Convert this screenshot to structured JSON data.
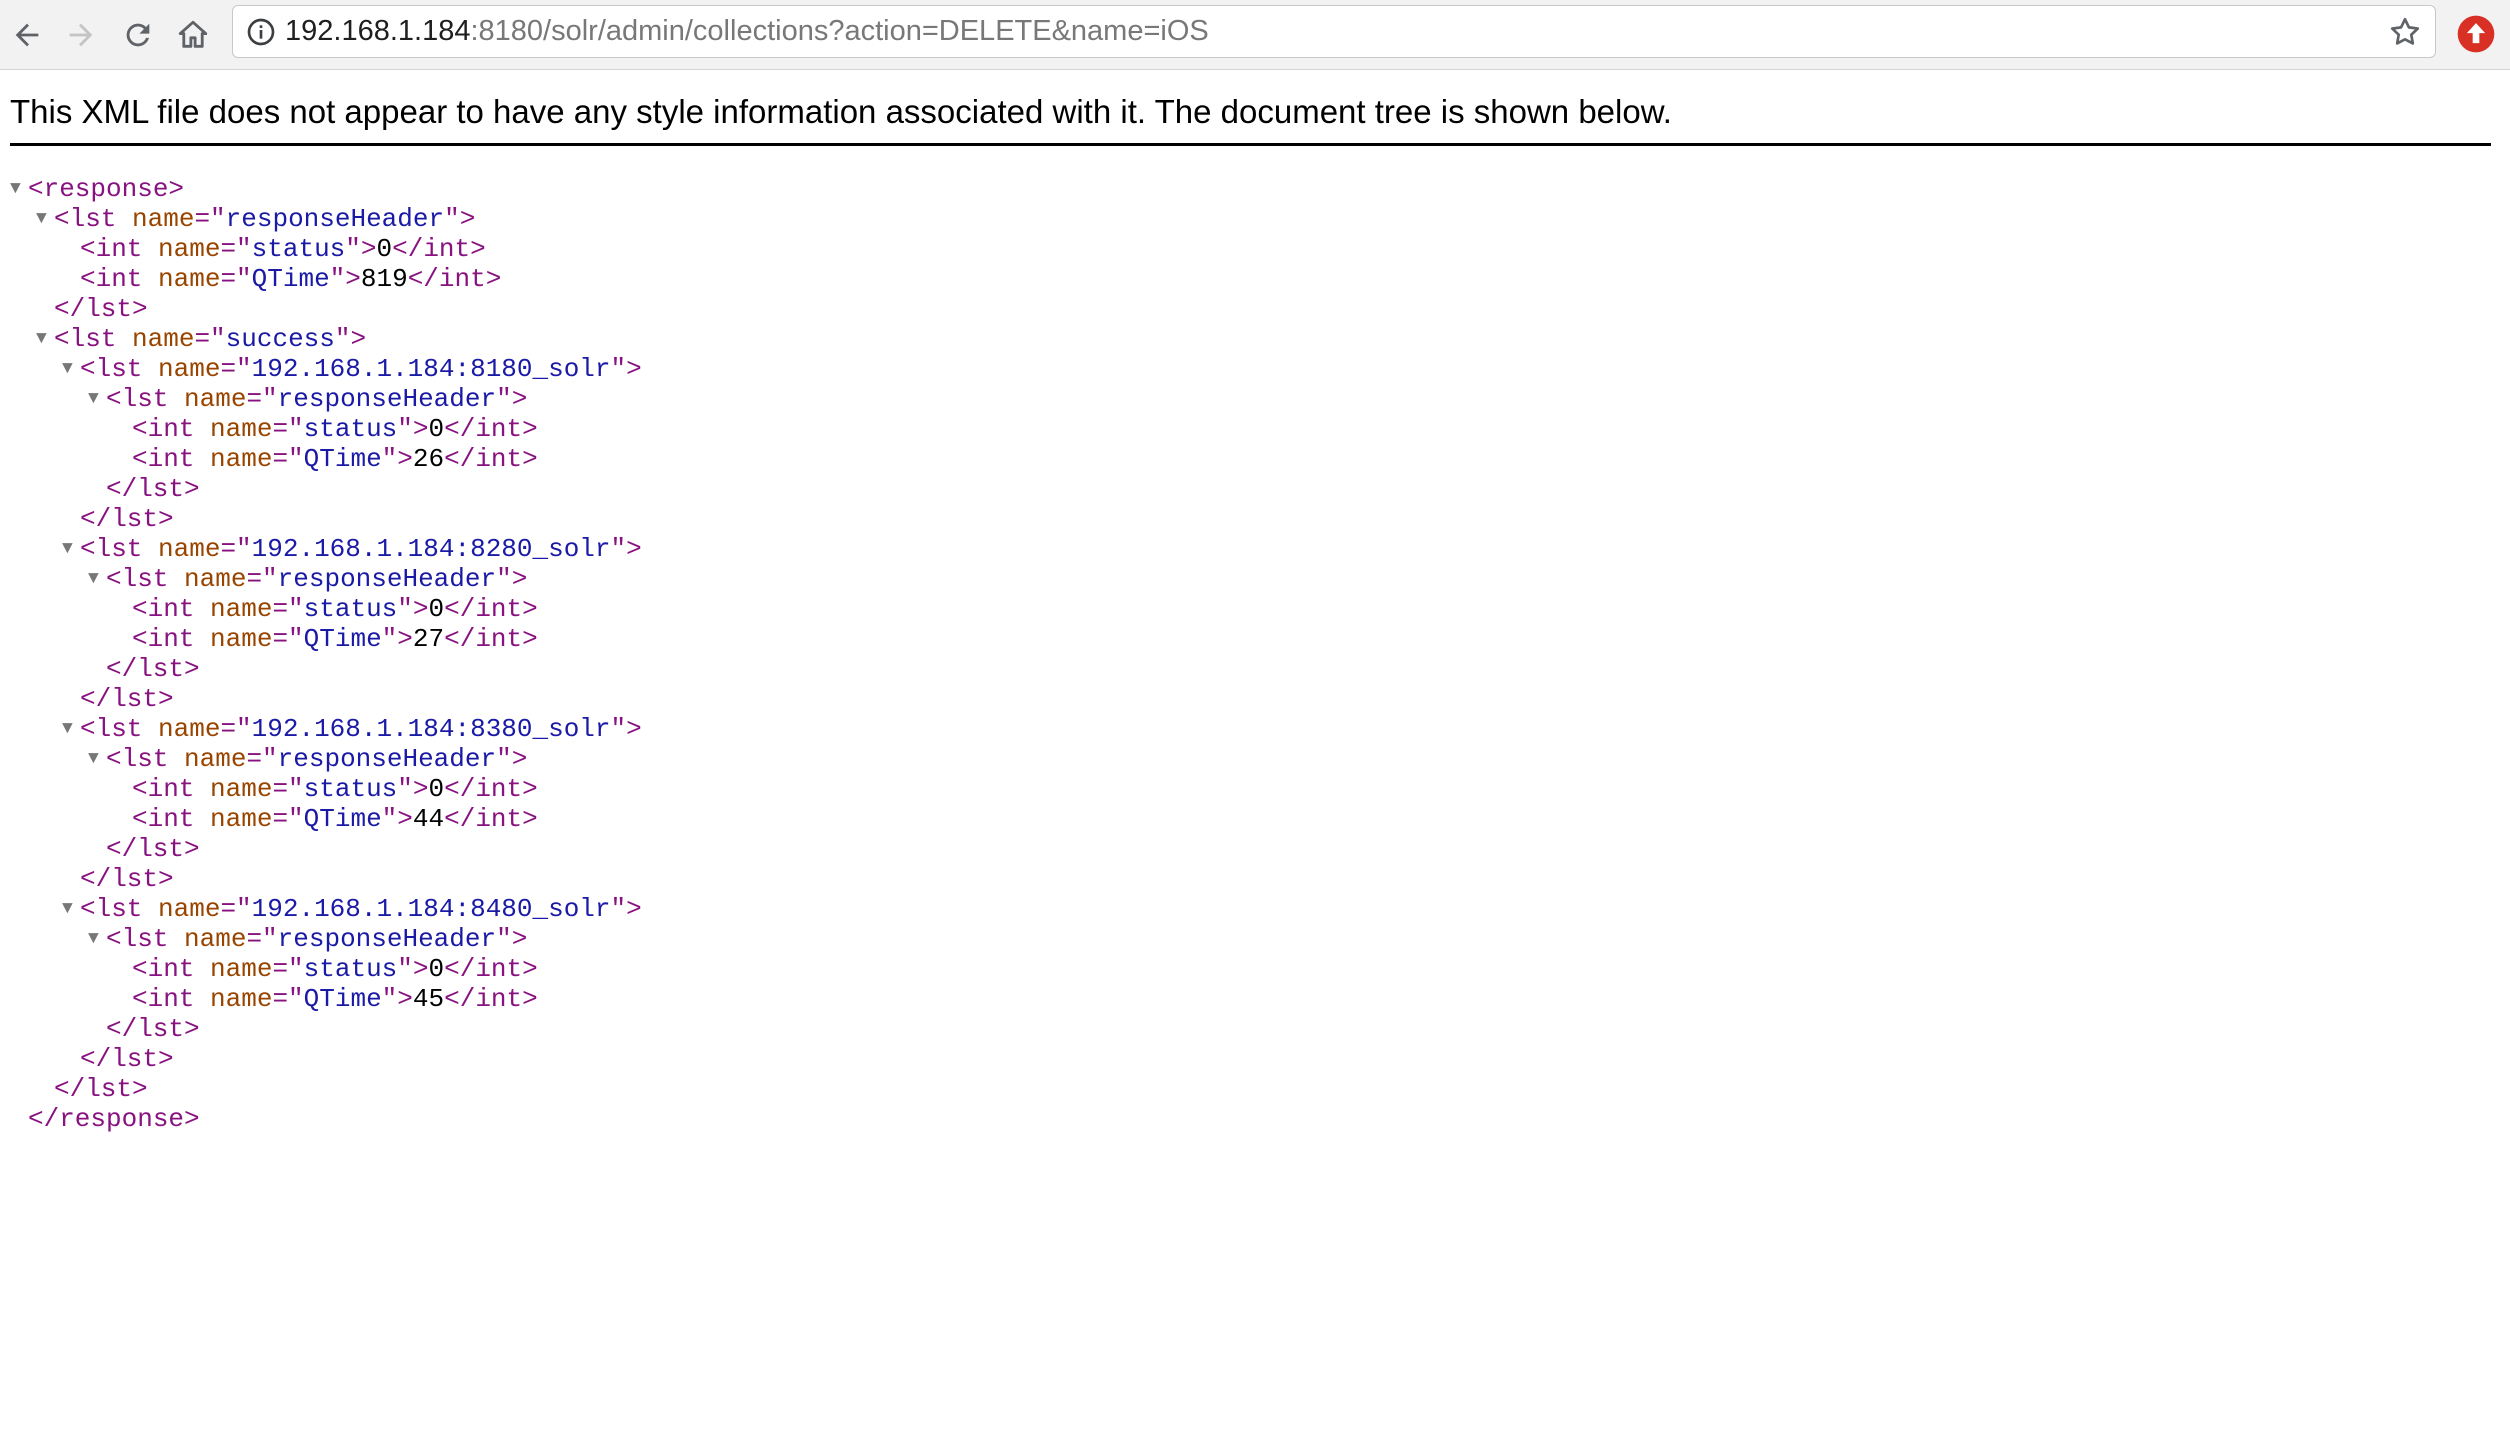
{
  "browser": {
    "url_host": "192.168.1.184",
    "url_rest": ":8180/solr/admin/collections?action=DELETE&name=iOS",
    "icons": {
      "back": "back-arrow-icon",
      "forward": "forward-arrow-icon",
      "reload": "reload-icon",
      "home": "home-icon",
      "info": "info-icon",
      "bookmark": "star-icon",
      "extension": "extension-icon"
    },
    "extension_color": "#d93025"
  },
  "notice": "This XML file does not appear to have any style information associated with it. The document tree is shown below.",
  "xml_tree": {
    "response_open": "<response>",
    "response_close": "</response>",
    "lst_close": "</lst>",
    "response_header": {
      "name": "responseHeader",
      "status": "0",
      "qtime": "819"
    },
    "success": {
      "name": "success",
      "nodes": [
        {
          "name": "192.168.1.184:8180_solr",
          "header_name": "responseHeader",
          "status": "0",
          "qtime": "26"
        },
        {
          "name": "192.168.1.184:8280_solr",
          "header_name": "responseHeader",
          "status": "0",
          "qtime": "27"
        },
        {
          "name": "192.168.1.184:8380_solr",
          "header_name": "responseHeader",
          "status": "0",
          "qtime": "44"
        },
        {
          "name": "192.168.1.184:8480_solr",
          "header_name": "responseHeader",
          "status": "0",
          "qtime": "45"
        }
      ]
    }
  },
  "colors": {
    "tag": "#881280",
    "attribute": "#994500",
    "attribute_value": "#1a1aa6"
  }
}
